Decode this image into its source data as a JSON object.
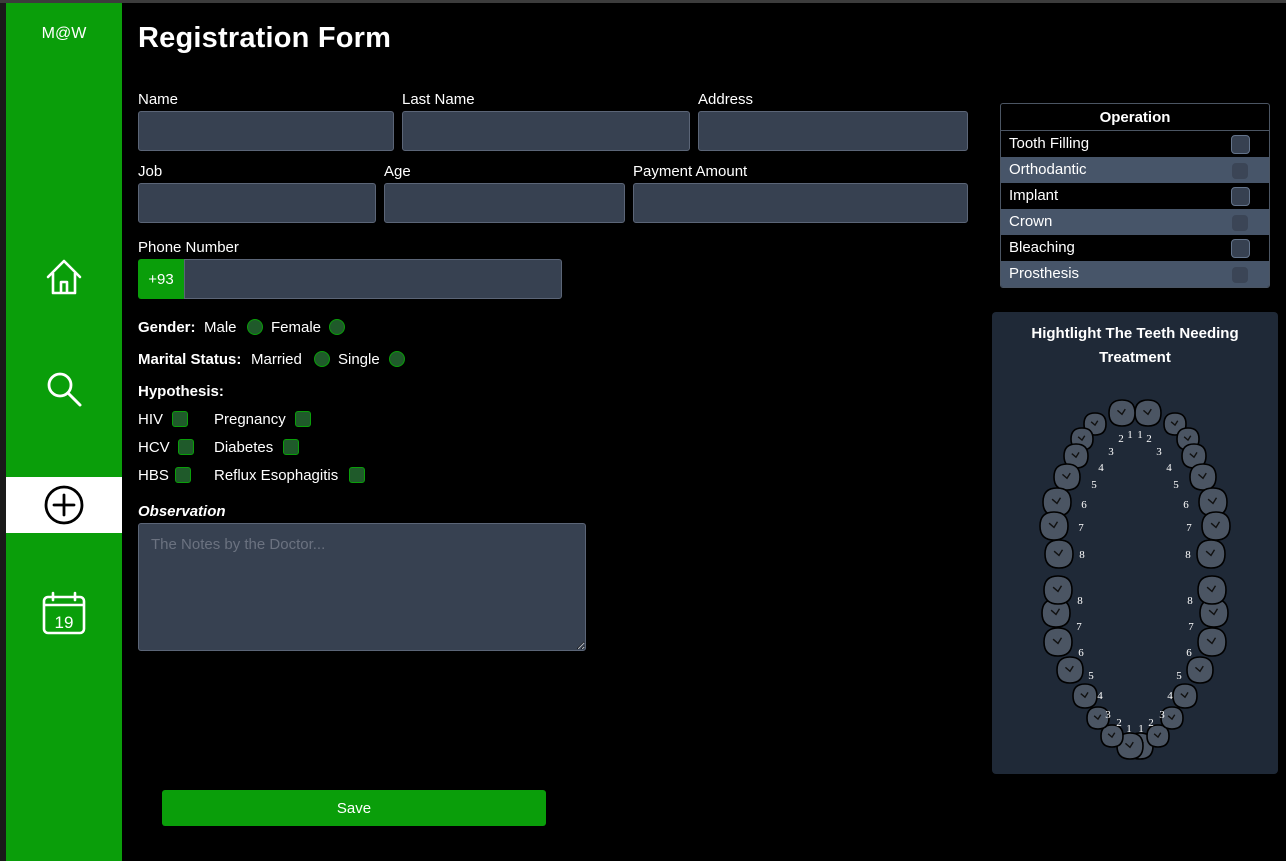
{
  "sidebar": {
    "logo": "M@W",
    "calendar_day": "19"
  },
  "form": {
    "title": "Registration Form",
    "labels": {
      "name": "Name",
      "last_name": "Last Name",
      "address": "Address",
      "job": "Job",
      "age": "Age",
      "payment_amount": "Payment Amount",
      "phone_number": "Phone Number"
    },
    "phone_prefix": "+93",
    "gender": {
      "label": "Gender:",
      "options": [
        "Male",
        "Female"
      ]
    },
    "marital_status": {
      "label": "Marital Status:",
      "options": [
        "Married",
        "Single"
      ]
    },
    "hypothesis": {
      "label": "Hypothesis:",
      "items": [
        "HIV",
        "Pregnancy",
        "HCV",
        "Diabetes",
        "HBS",
        "Reflux Esophagitis"
      ]
    },
    "observation": {
      "label": "Observation",
      "placeholder": "The Notes by the Doctor..."
    },
    "save_label": "Save"
  },
  "operations": {
    "header": "Operation",
    "items": [
      "Tooth Filling",
      "Orthodantic",
      "Implant",
      "Crown",
      "Bleaching",
      "Prosthesis"
    ]
  },
  "teeth_chart": {
    "title_line1": "Hightlight The Teeth Needing",
    "title_line2": "Treatment",
    "numbers": [
      "1",
      "2",
      "3",
      "4",
      "5",
      "6",
      "7",
      "8"
    ]
  },
  "colors": {
    "accent": "#0a9e0a",
    "input_bg": "#374151",
    "panel_bg": "#1f2937",
    "tooth_fill": "#4b5563"
  }
}
